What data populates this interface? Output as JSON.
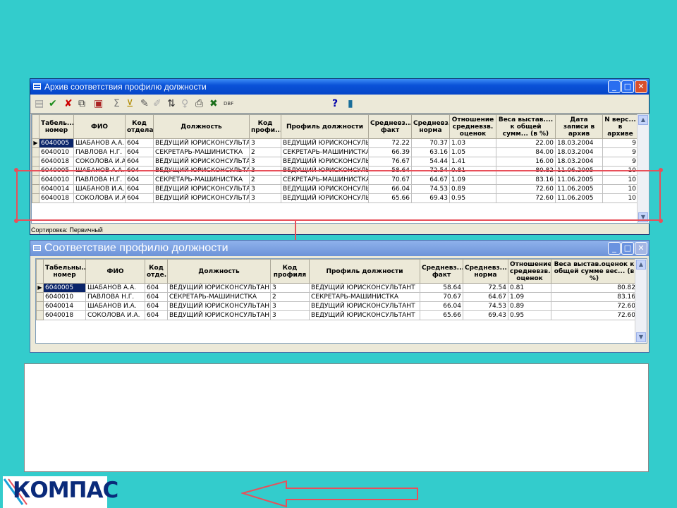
{
  "archive_window": {
    "title": "Архив соответствия профилю должности",
    "columns": [
      "Табель... номер",
      "ФИО",
      "Код отдела",
      "Должность",
      "Код профи...",
      "Профиль должности",
      "Средневз... факт",
      "Средневз... норма",
      "Отношение средневзв. оценок",
      "Веса выстав.... к общей сумм... (в %)",
      "Дата записи в архив",
      "N верс... в архиве"
    ],
    "rows": [
      [
        "6040005",
        "ШАБАНОВ А.А.",
        "604",
        "ВЕДУЩИЙ ЮРИСКОНСУЛЬТА",
        "3",
        "ВЕДУЩИЙ ЮРИСКОНСУЛЬ",
        "72.22",
        "70.37",
        "1.03",
        "22.00",
        "18.03.2004",
        "9"
      ],
      [
        "6040010",
        "ПАВЛОВА Н.Г.",
        "604",
        "СЕКРЕТАРЬ-МАШИНИСТКА",
        "2",
        "СЕКРЕТАРЬ-МАШИНИСТКА",
        "66.39",
        "63.16",
        "1.05",
        "84.00",
        "18.03.2004",
        "9"
      ],
      [
        "6040018",
        "СОКОЛОВА И.А.",
        "604",
        "ВЕДУЩИЙ ЮРИСКОНСУЛЬТА",
        "3",
        "ВЕДУЩИЙ ЮРИСКОНСУЛЬ",
        "76.67",
        "54.44",
        "1.41",
        "16.00",
        "18.03.2004",
        "9"
      ],
      [
        "6040005",
        "ШАБАНОВ А.А.",
        "604",
        "ВЕДУЩИЙ ЮРИСКОНСУЛЬТА",
        "3",
        "ВЕДУЩИЙ ЮРИСКОНСУЛЬ",
        "58.64",
        "72.54",
        "0.81",
        "80.82",
        "11.06.2005",
        "10"
      ],
      [
        "6040010",
        "ПАВЛОВА Н.Г.",
        "604",
        "СЕКРЕТАРЬ-МАШИНИСТКА",
        "2",
        "СЕКРЕТАРЬ-МАШИНИСТКА",
        "70.67",
        "64.67",
        "1.09",
        "83.16",
        "11.06.2005",
        "10"
      ],
      [
        "6040014",
        "ШАБАНОВ И.А.",
        "604",
        "ВЕДУЩИЙ ЮРИСКОНСУЛЬТА",
        "3",
        "ВЕДУЩИЙ ЮРИСКОНСУЛЬ",
        "66.04",
        "74.53",
        "0.89",
        "72.60",
        "11.06.2005",
        "10"
      ],
      [
        "6040018",
        "СОКОЛОВА И.А.",
        "604",
        "ВЕДУЩИЙ ЮРИСКОНСУЛЬТА",
        "3",
        "ВЕДУЩИЙ ЮРИСКОНСУЛЬ",
        "65.66",
        "69.43",
        "0.95",
        "72.60",
        "11.06.2005",
        "10"
      ]
    ],
    "status": "Сортировка: Первичный"
  },
  "profile_window": {
    "title": "Соответствие профилю должности",
    "columns": [
      "Табельны... номер",
      "ФИО",
      "Код отде...",
      "Должность",
      "Код профиля",
      "Профиль должности",
      "Средневз... факт",
      "Средневз... норма",
      "Отношение средневзв. оценок",
      "Веса выстав.оценок к общей сумме вес... (в %)"
    ],
    "rows": [
      [
        "6040005",
        "ШАБАНОВ А.А.",
        "604",
        "ВЕДУЩИЙ ЮРИСКОНСУЛЬТАН",
        "3",
        "ВЕДУЩИЙ ЮРИСКОНСУЛЬТАНТ",
        "58.64",
        "72.54",
        "0.81",
        "80.82"
      ],
      [
        "6040010",
        "ПАВЛОВА Н.Г.",
        "604",
        "СЕКРЕТАРЬ-МАШИНИСТКА",
        "2",
        "СЕКРЕТАРЬ-МАШИНИСТКА",
        "70.67",
        "64.67",
        "1.09",
        "83.16"
      ],
      [
        "6040014",
        "ШАБАНОВ И.А.",
        "604",
        "ВЕДУЩИЙ ЮРИСКОНСУЛЬТАН",
        "3",
        "ВЕДУЩИЙ ЮРИСКОНСУЛЬТАНТ",
        "66.04",
        "74.53",
        "0.89",
        "72.60"
      ],
      [
        "6040018",
        "СОКОЛОВА И.А.",
        "604",
        "ВЕДУЩИЙ ЮРИСКОНСУЛЬТАН",
        "3",
        "ВЕДУЩИЙ ЮРИСКОНСУЛЬТАНТ",
        "65.66",
        "69.43",
        "0.95",
        "72.60"
      ]
    ]
  },
  "toolbar": {
    "dbf_label": "DBF",
    "help_label": "?"
  },
  "logo": {
    "text": "КОМПАС"
  },
  "colors": {
    "background": "#33cccc",
    "highlight": "#e8505a",
    "titlebar": "#0a52d8"
  },
  "icons": [
    "grid-icon",
    "check-icon",
    "cancel-icon",
    "copy-record-icon",
    "save-record-icon",
    "sum-icon",
    "filter-icon",
    "clear-filter-icon",
    "sort-icon",
    "hint-icon",
    "print-icon",
    "excel-icon",
    "dbf-export-icon",
    "help-icon",
    "exit-icon"
  ]
}
